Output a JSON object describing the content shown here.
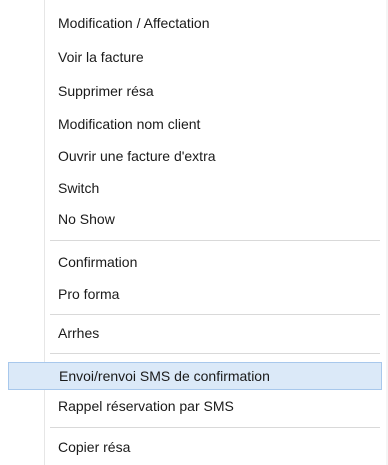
{
  "context_menu": {
    "items": [
      {
        "label": "Modification / Affectation"
      },
      {
        "label": "Voir la facture"
      },
      {
        "label": "Supprimer résa"
      },
      {
        "label": "Modification nom client"
      },
      {
        "label": "Ouvrir une facture d'extra"
      },
      {
        "label": "Switch"
      },
      {
        "label": "No Show"
      },
      {
        "label": "Confirmation"
      },
      {
        "label": "Pro forma"
      },
      {
        "label": "Arrhes"
      },
      {
        "label": "Envoi/renvoi SMS de confirmation"
      },
      {
        "label": "Rappel réservation par SMS"
      },
      {
        "label": "Copier résa"
      }
    ],
    "highlighted_item": "Envoi/renvoi SMS de confirmation",
    "colors": {
      "highlight_background": "#dbe9f8",
      "highlight_border": "#a8c8ec",
      "separator": "#d9d9d9",
      "text": "#1a1a1a"
    }
  }
}
